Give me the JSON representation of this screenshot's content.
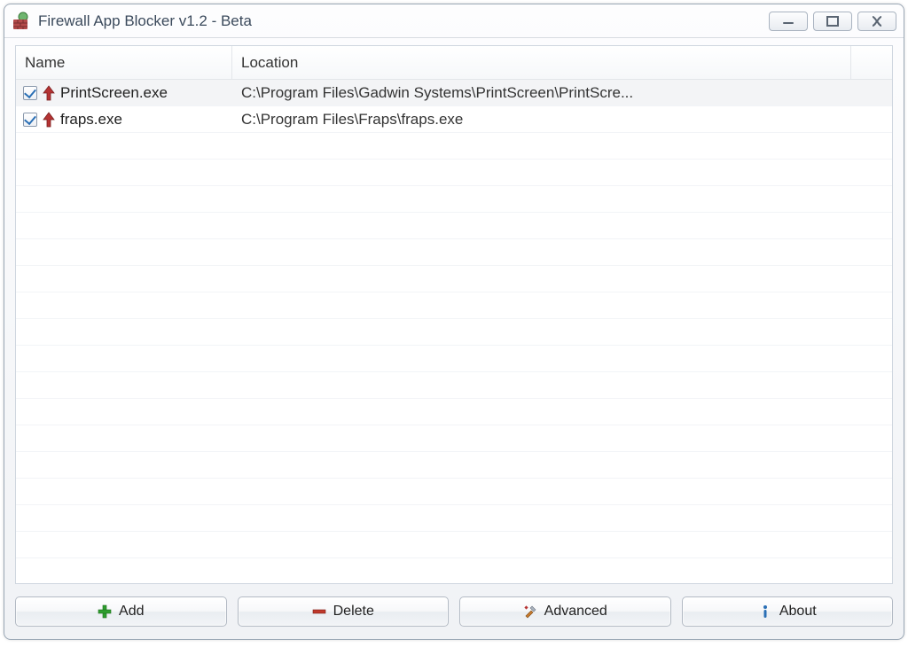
{
  "window": {
    "title": "Firewall App Blocker v1.2 - Beta"
  },
  "columns": {
    "name": "Name",
    "location": "Location"
  },
  "rows": [
    {
      "checked": true,
      "name": "PrintScreen.exe",
      "location": "C:\\Program Files\\Gadwin Systems\\PrintScreen\\PrintScre..."
    },
    {
      "checked": true,
      "name": "fraps.exe",
      "location": "C:\\Program Files\\Fraps\\fraps.exe"
    }
  ],
  "toolbar": {
    "add": "Add",
    "delete": "Delete",
    "advanced": "Advanced",
    "about": "About"
  }
}
